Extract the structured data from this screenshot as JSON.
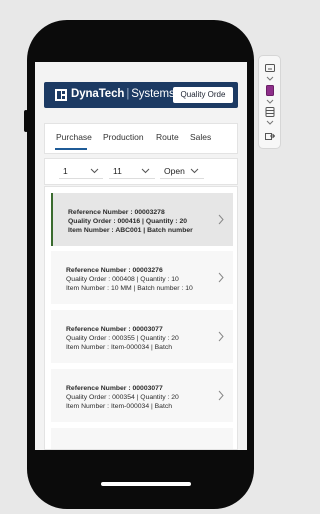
{
  "header": {
    "brand_bold": "DynaTech",
    "brand_separator": "|",
    "brand_light": "Systems",
    "button_label": "Quality Orde"
  },
  "tabs": [
    {
      "label": "Purchase",
      "active": true
    },
    {
      "label": "Production",
      "active": false
    },
    {
      "label": "Route",
      "active": false
    },
    {
      "label": "Sales",
      "active": false
    }
  ],
  "filters": [
    {
      "value": "1"
    },
    {
      "value": "11"
    },
    {
      "value": "Open"
    }
  ],
  "items": [
    {
      "reference": "Reference Number : 00003278",
      "line2": "Quality Order : 000416 | Quantity : 20",
      "line3": "Item Number : ABC001 | Batch number",
      "selected": true
    },
    {
      "reference": "Reference Number : 00003276",
      "line2": "Quality Order : 000408 | Quantity : 10",
      "line3": "Item Number : 10 MM | Batch number : 10",
      "selected": false
    },
    {
      "reference": "Reference Number : 00003077",
      "line2": "Quality Order : 000355 | Quantity : 20",
      "line3": "Item Number : Item-000034 | Batch",
      "selected": false
    },
    {
      "reference": "Reference Number : 00003077",
      "line2": "Quality Order : 000354 | Quantity : 20",
      "line3": "Item Number : Item-000034 | Batch",
      "selected": false
    }
  ],
  "side_panel": {
    "icons": [
      "display-icon",
      "color-swatch-icon",
      "device-stack-icon",
      "export-icon"
    ]
  },
  "colors": {
    "header_bg": "#1c3a63",
    "tab_accent": "#1f5b97",
    "selected_accent": "#3a6b2f"
  }
}
